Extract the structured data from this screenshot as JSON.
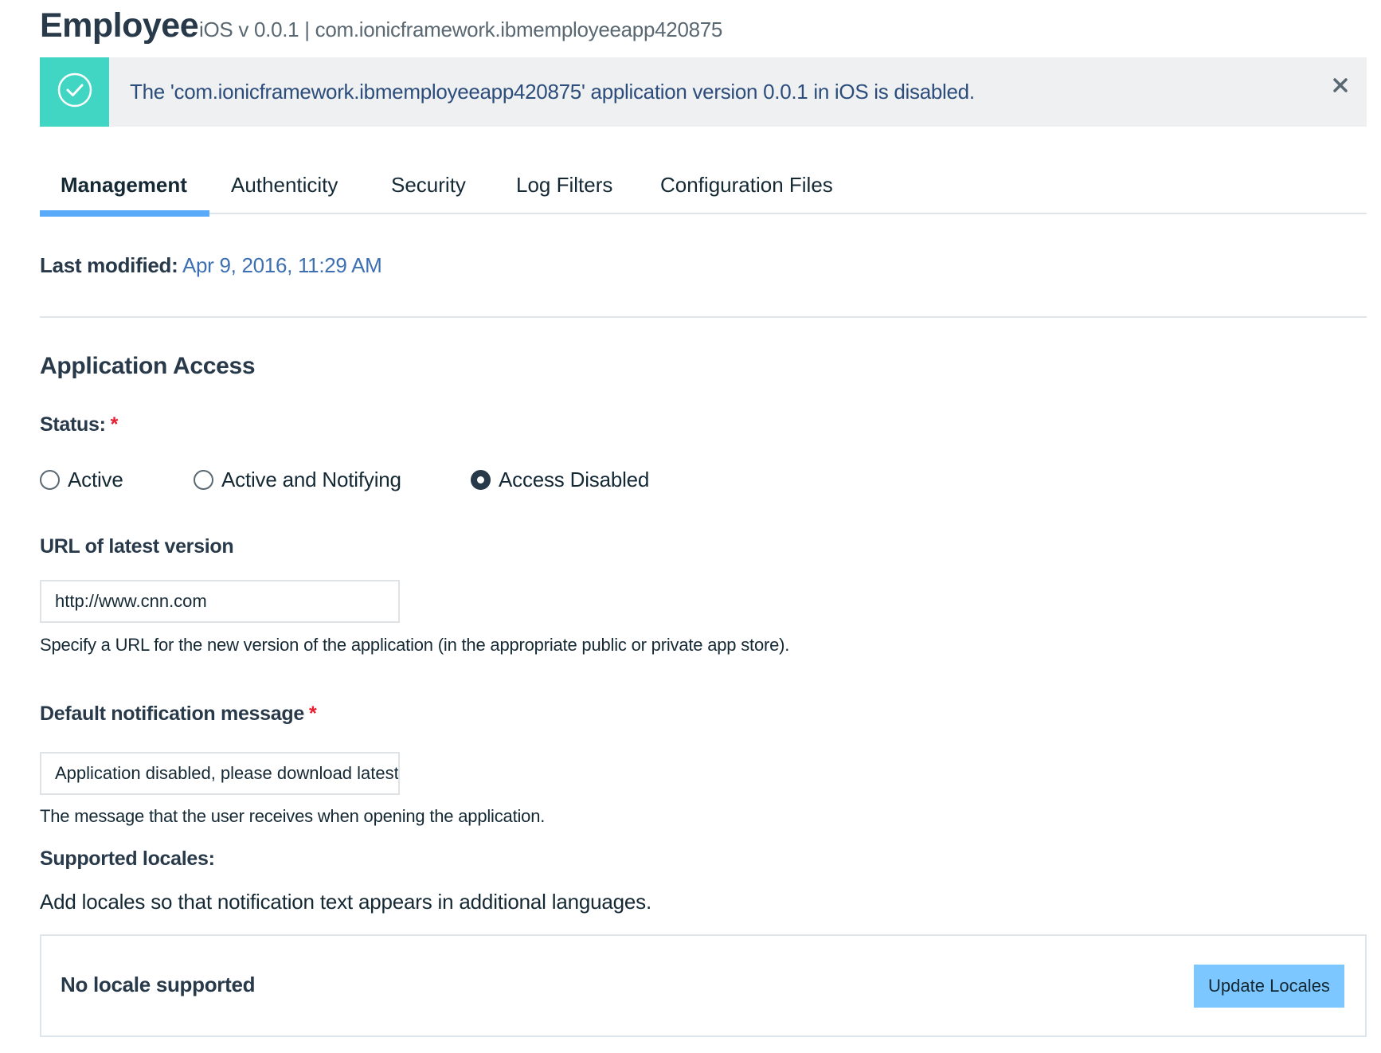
{
  "header": {
    "title": "Employee",
    "subtitle": "iOS v 0.0.1 | com.ionicframework.ibmemployeeapp420875"
  },
  "notification": {
    "message": "The 'com.ionicframework.ibmemployeeapp420875' application version 0.0.1 in iOS is disabled.",
    "icon": "check-circle-icon",
    "close_icon": "close-icon",
    "accent_color": "#41d6c3"
  },
  "tabs": [
    {
      "label": "Management",
      "active": true
    },
    {
      "label": "Authenticity",
      "active": false
    },
    {
      "label": "Security",
      "active": false
    },
    {
      "label": "Log Filters",
      "active": false
    },
    {
      "label": "Configuration Files",
      "active": false
    }
  ],
  "last_modified": {
    "label": "Last modified:",
    "value": " Apr 9, 2016, 11:29 AM"
  },
  "application_access": {
    "title": "Application Access",
    "status_label": "Status:",
    "required_mark": "*",
    "status_options": [
      {
        "label": "Active",
        "checked": false
      },
      {
        "label": "Active and Notifying",
        "checked": false
      },
      {
        "label": "Access Disabled",
        "checked": true
      }
    ],
    "url_label": "URL of latest version",
    "url_value": "http://www.cnn.com",
    "url_help": "Specify a URL for the new version of the application (in the appropriate public or private app store).",
    "message_label": "Default notification message",
    "message_value": "Application disabled, please download latest",
    "message_help": "The message that the user receives when opening the application.",
    "locales_label": "Supported locales:",
    "locales_help": "Add locales so that notification text appears in additional languages.",
    "locales_empty": "No locale supported",
    "update_button": "Update Locales"
  },
  "colors": {
    "primary_text": "#28394a",
    "tab_active_underline": "#5aaafa",
    "button_bg": "#7cc7ff",
    "required": "#e71d32"
  }
}
